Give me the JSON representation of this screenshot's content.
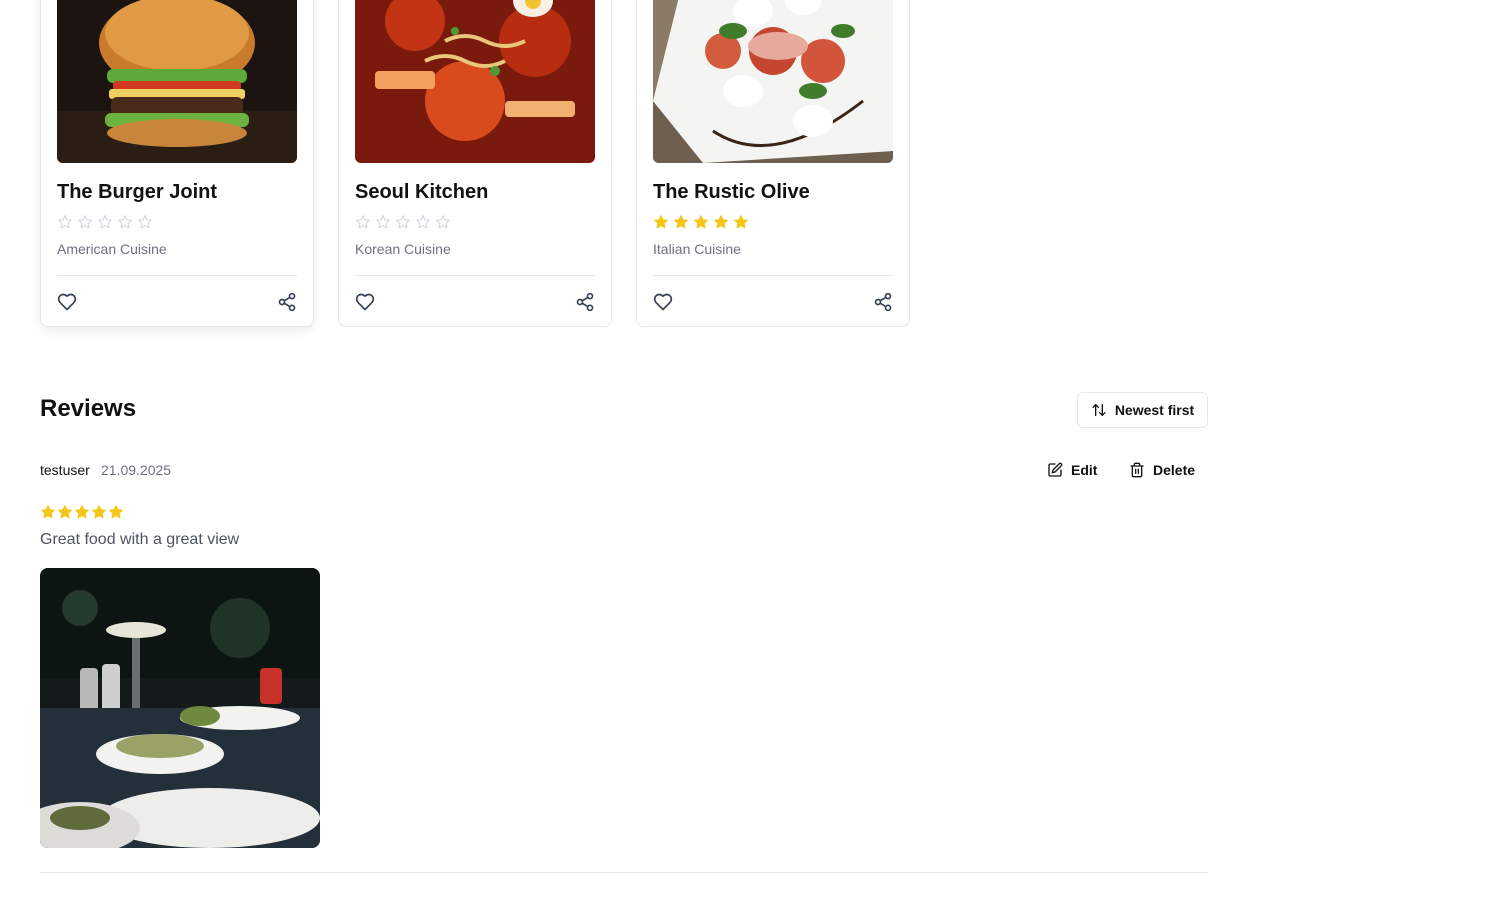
{
  "restaurants": [
    {
      "name": "The Burger Joint",
      "cuisine": "American Cuisine",
      "rating": 0,
      "image_icon": "burger-photo"
    },
    {
      "name": "Seoul Kitchen",
      "cuisine": "Korean Cuisine",
      "rating": 0,
      "image_icon": "korean-stew-photo"
    },
    {
      "name": "The Rustic Olive",
      "cuisine": "Italian Cuisine",
      "rating": 5,
      "image_icon": "caprese-photo"
    }
  ],
  "reviews_section": {
    "title": "Reviews",
    "sort_label": "Newest first"
  },
  "review": {
    "user": "testuser",
    "date": "21.09.2025",
    "rating": 5,
    "text": "Great food with a great view",
    "edit_label": "Edit",
    "delete_label": "Delete",
    "photo_icon": "dinner-table-photo"
  },
  "colors": {
    "star_filled": "#f5c518",
    "star_empty": "#d1d5db",
    "muted_text": "#6b7280",
    "border": "#e5e7eb"
  }
}
